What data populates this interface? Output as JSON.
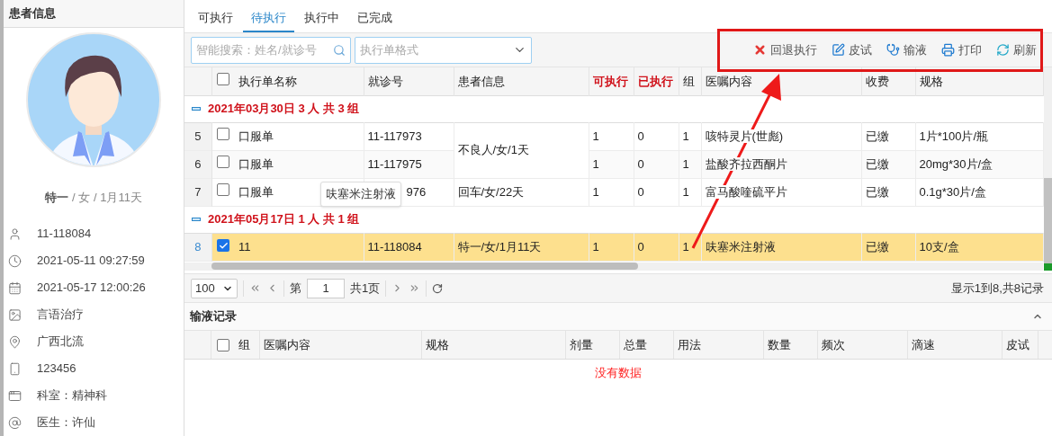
{
  "patient_panel": {
    "title": "患者信息",
    "name": "特一",
    "summary": "/ 女 / 1月11天",
    "details": [
      {
        "kind": "person",
        "text": "11-118084"
      },
      {
        "kind": "clock",
        "text": "2021-05-11 09:27:59"
      },
      {
        "kind": "calendar",
        "text": "2021-05-17 12:00:26"
      },
      {
        "kind": "image",
        "text": "言语治疗"
      },
      {
        "kind": "location",
        "text": "广西北流"
      },
      {
        "kind": "phone",
        "text": "123456"
      },
      {
        "kind": "window",
        "text": "科室：精神科"
      },
      {
        "kind": "at",
        "text": "医生：许仙"
      }
    ]
  },
  "tabs": [
    {
      "label": "可执行",
      "selected": false
    },
    {
      "label": "待执行",
      "selected": true
    },
    {
      "label": "执行中",
      "selected": false
    },
    {
      "label": "已完成",
      "selected": false
    }
  ],
  "toolbar": {
    "search_placeholder": "智能搜索：姓名/就诊号",
    "format_placeholder": "执行单格式",
    "actions": [
      {
        "kind": "rollback",
        "label": "回退执行"
      },
      {
        "kind": "edit",
        "label": "皮试"
      },
      {
        "kind": "infusion",
        "label": "输液"
      },
      {
        "kind": "print",
        "label": "打印"
      },
      {
        "kind": "refresh",
        "label": "刷新"
      }
    ]
  },
  "orders_table": {
    "all_checked": false,
    "columns": [
      {
        "label": "执行单名称",
        "emphasis": false
      },
      {
        "label": "就诊号",
        "emphasis": false
      },
      {
        "label": "患者信息",
        "emphasis": false
      },
      {
        "label": "可执行",
        "emphasis": true
      },
      {
        "label": "已执行",
        "emphasis": true
      },
      {
        "label": "组",
        "emphasis": false
      },
      {
        "label": "医嘱内容",
        "emphasis": false
      },
      {
        "label": "收费",
        "emphasis": false
      },
      {
        "label": "规格",
        "emphasis": false
      }
    ],
    "groups": [
      {
        "title": "2021年03月30日 3 人 共 3 组",
        "rows": [
          {
            "index": "5",
            "checked": false,
            "selected": false,
            "name": "口服单",
            "visit": "11-117973",
            "patient": "不良人/女/1天",
            "executable": "1",
            "executed": "0",
            "group": "1",
            "order": "咳特灵片(世彪)",
            "fee": "已缴",
            "spec": "1片*100片/瓶"
          },
          {
            "index": "6",
            "checked": false,
            "selected": false,
            "name": "口服单",
            "visit": "11-117975",
            "executable": "1",
            "executed": "0",
            "group": "1",
            "order": "盐酸齐拉西酮片",
            "fee": "已缴",
            "spec": "20mg*30片/盒"
          },
          {
            "index": "7",
            "checked": false,
            "selected": false,
            "name": "口服单",
            "visit": "976",
            "patient": "回车/女/22天",
            "executable": "1",
            "executed": "0",
            "group": "1",
            "order": "富马酸喹硫平片",
            "fee": "已缴",
            "spec": "0.1g*30片/盒"
          }
        ]
      },
      {
        "title": "2021年05月17日 1 人 共 1 组",
        "rows": [
          {
            "index": "8",
            "checked": true,
            "selected": true,
            "name": "11",
            "visit": "11-118084",
            "patient": "特一/女/1月11天",
            "executable": "1",
            "executed": "0",
            "group": "1",
            "order": "呋塞米注射液",
            "fee": "已缴",
            "spec": "10支/盒"
          }
        ]
      }
    ],
    "tooltip": "呋塞米注射液"
  },
  "pager": {
    "page_size": "100",
    "page_prefix": "第",
    "page": "1",
    "total_pages": "共1页",
    "summary": "显示1到8,共8记录"
  },
  "infusion_records": {
    "all_checked": false,
    "title": "输液记录",
    "columns": [
      "组",
      "医嘱内容",
      "规格",
      "剂量",
      "总量",
      "用法",
      "数量",
      "频次",
      "滴速",
      "皮试"
    ],
    "empty_text": "没有数据"
  }
}
